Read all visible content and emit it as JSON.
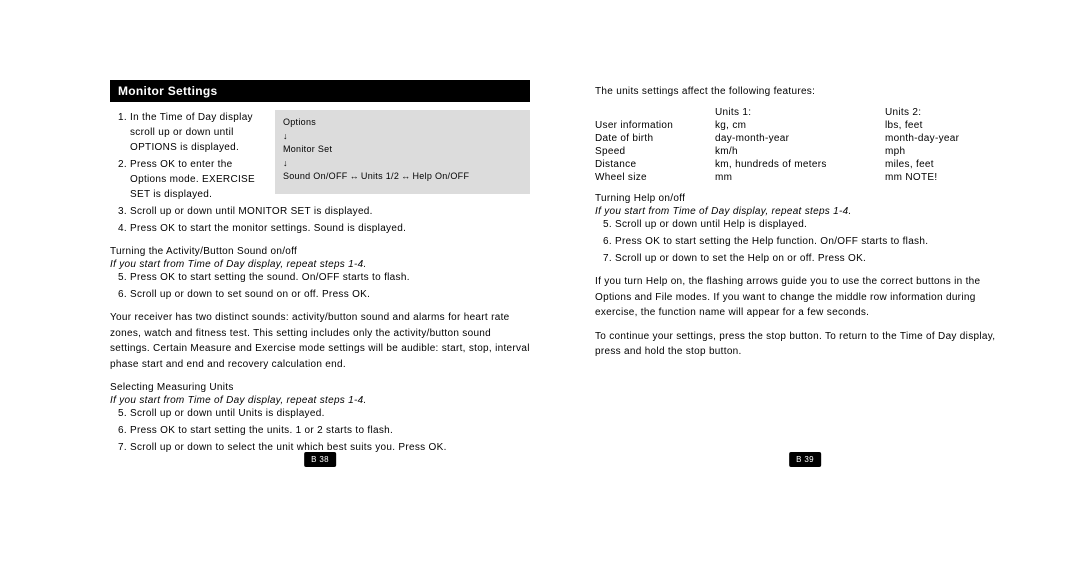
{
  "left": {
    "section_title": "Monitor Settings",
    "steps_a": [
      "In the Time of Day display scroll up or down until OPTIONS is displayed.",
      "Press OK to enter the Options mode. EXERCISE SET is displayed.",
      "Scroll up or down until MONITOR SET is displayed.",
      "Press OK to start the monitor settings. Sound is displayed."
    ],
    "box": {
      "l1": "Options",
      "l2": "Monitor Set",
      "seg1": "Sound On/OFF",
      "seg2": "Units 1/2",
      "seg3": "Help On/OFF"
    },
    "sub1_title": "Turning the Activity/Button Sound on/off",
    "sub1_note": "If you start from Time of Day display, repeat steps 1-4.",
    "steps_b": [
      "Press OK to start setting the sound. On/OFF starts to flash.",
      "Scroll up or down to set sound on or off. Press OK."
    ],
    "para1": "Your receiver has two distinct sounds: activity/button sound and alarms for heart rate zones, watch and fitness test. This setting includes only the activity/button sound settings. Certain Measure and Exercise mode settings will be audible: start, stop, interval phase start and end and recovery calculation end.",
    "sub2_title": "Selecting Measuring Units",
    "sub2_note": "If you start from Time of Day display, repeat steps 1-4.",
    "steps_c": [
      "Scroll up or down until Units is displayed.",
      "Press OK to start setting the units. 1 or 2 starts to flash.",
      "Scroll up or down to select the unit which best suits you. Press OK."
    ],
    "page_num": "B 38"
  },
  "right": {
    "intro": "The units settings affect the following features:",
    "table": {
      "h1": "Units 1:",
      "h2": "Units 2:",
      "rows": [
        [
          "User information",
          "kg, cm",
          "lbs, feet"
        ],
        [
          "Date of birth",
          "day-month-year",
          "month-day-year"
        ],
        [
          "Speed",
          "km/h",
          "mph"
        ],
        [
          "Distance",
          "km, hundreds of meters",
          "miles, feet"
        ],
        [
          "Wheel size",
          "mm",
          "mm NOTE!"
        ]
      ]
    },
    "sub_title": "Turning Help on/off",
    "sub_note": "If you start from Time of Day display, repeat steps 1-4.",
    "steps": [
      "Scroll up or down until Help is displayed.",
      "Press OK to start setting the Help function. On/OFF starts to flash.",
      "Scroll up or down to set the Help on or off. Press OK."
    ],
    "para1": "If you turn Help on, the flashing arrows guide you to use the correct buttons in the Options and File modes. If you want to change the middle row information during exercise, the function name will appear for a few seconds.",
    "para2": "To continue your settings, press the stop button. To return to the Time of Day display, press and hold the stop button.",
    "page_num": "B 39"
  }
}
